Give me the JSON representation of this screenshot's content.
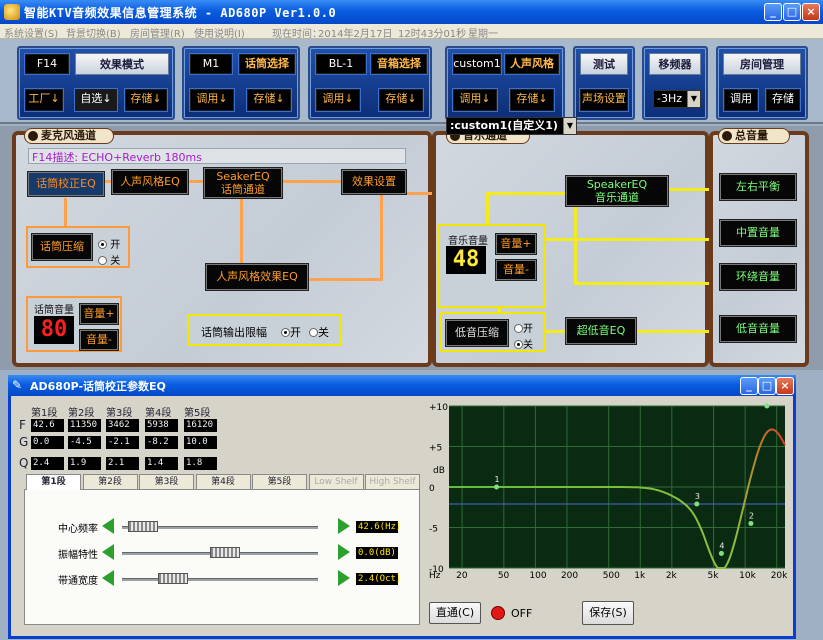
{
  "window": {
    "title": "智能KTV音频效果信息管理系统 - AD680P Ver1.0.0"
  },
  "menu": {
    "items": [
      "系统设置(S)",
      "背景切换(B)",
      "房间管理(R)",
      "使用说明(I)"
    ],
    "time_label": "现在时间：",
    "date": "2014年2月17日",
    "time": "12时43分01秒",
    "weekday": "星期一"
  },
  "top": {
    "mode": {
      "code": "F14",
      "label": "效果模式",
      "btn1": "工厂↓",
      "btn2": "自选↓",
      "btn3": "存储↓"
    },
    "mic": {
      "code": "M1",
      "label": "话筒选择",
      "btn1": "调用↓",
      "btn2": "存储↓"
    },
    "speaker": {
      "code": "BL-1",
      "label": "音箱选择",
      "btn1": "调用↓",
      "btn2": "存储↓"
    },
    "voice": {
      "code": "custom1",
      "label": "人声风格",
      "btn1": "调用↓",
      "btn2": "存储↓"
    },
    "test": {
      "label": "测试",
      "btn": "声场设置"
    },
    "shift": {
      "label": "移频器",
      "value": "-3Hz"
    },
    "room": {
      "label": "房间管理",
      "btn1": "调用",
      "btn2": "存储"
    },
    "voice_dropdown": ":custom1(自定义1)"
  },
  "mic_channel": {
    "header": "麦克风通道",
    "description": "F14描述: ECHO+Reverb 180ms",
    "node_mic_eq": "话筒校正EQ",
    "node_voice_style_eq": "人声风格EQ",
    "node_speaker_eq": "SeakerEQ\n话筒通道",
    "node_effect": "效果设置",
    "node_voice_effect_eq": "人声风格效果EQ",
    "compress_label": "话筒压缩",
    "compress_on": "开",
    "compress_off": "关",
    "vol_label": "话筒音量",
    "vol_value": "80",
    "vol_up": "音量+",
    "vol_down": "音量-",
    "limit_label": "话筒输出限幅",
    "limit_on": "开",
    "limit_off": "关"
  },
  "music_channel": {
    "header": "音乐通道",
    "vol_label": "音乐音量",
    "vol_value": "48",
    "vol_up": "音量+",
    "vol_down": "音量-",
    "node_speaker_eq": "SpeakerEQ\n音乐通道",
    "bass_compress": "低音压缩",
    "bass_on": "开",
    "bass_off": "关",
    "node_sub_eq": "超低音EQ"
  },
  "master": {
    "header": "总音量",
    "balance": "左右平衡",
    "center": "中置音量",
    "surround": "环绕音量",
    "bass": "低音音量"
  },
  "eq": {
    "title": "AD680P-话筒校正参数EQ",
    "row_labels": [
      "F",
      "G",
      "Q"
    ],
    "columns": [
      "第1段",
      "第2段",
      "第3段",
      "第4段",
      "第5段"
    ],
    "F": [
      "42.6",
      "11350",
      "3462",
      "5938",
      "16120"
    ],
    "G": [
      "0.0",
      "-4.5",
      "-2.1",
      "-8.2",
      "10.0"
    ],
    "Q": [
      "2.4",
      "1.9",
      "2.1",
      "1.4",
      "1.8"
    ],
    "tabs": [
      "第1段",
      "第2段",
      "第3段",
      "第4段",
      "第5段",
      "Low Shelf",
      "High Shelf"
    ],
    "freq_label": "中心频率",
    "freq_value": "42.6(Hz)",
    "gain_label": "振幅特性",
    "gain_value": "0.0(dB)",
    "bw_label": "带通宽度",
    "bw_value": "2.4(Oct)",
    "bypass": "直通(C)",
    "led_state": "OFF",
    "save": "保存(S)",
    "graph": {
      "y_ticks": [
        "+10",
        "+5",
        "0",
        "-5",
        "-10"
      ],
      "y_unit": "dB",
      "x_unit": "Hz",
      "x_ticks": [
        "20",
        "50",
        "100",
        "200",
        "500",
        "1k",
        "2k",
        "5k",
        "10k",
        "20k"
      ],
      "point_labels": [
        "1",
        "2",
        "3",
        "4",
        "5"
      ]
    }
  }
}
